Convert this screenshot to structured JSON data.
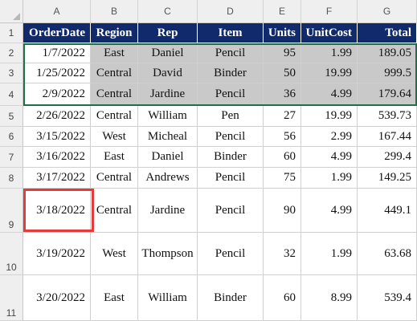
{
  "columns": [
    "A",
    "B",
    "C",
    "D",
    "E",
    "F",
    "G"
  ],
  "rows": [
    "1",
    "2",
    "3",
    "4",
    "5",
    "6",
    "7",
    "8",
    "9",
    "10",
    "11"
  ],
  "headers": [
    "OrderDate",
    "Region",
    "Rep",
    "Item",
    "Units",
    "UnitCost",
    "Total"
  ],
  "data": [
    [
      "1/7/2022",
      "East",
      "Daniel",
      "Pencil",
      "95",
      "1.99",
      "189.05"
    ],
    [
      "1/25/2022",
      "Central",
      "David",
      "Binder",
      "50",
      "19.99",
      "999.5"
    ],
    [
      "2/9/2022",
      "Central",
      "Jardine",
      "Pencil",
      "36",
      "4.99",
      "179.64"
    ],
    [
      "2/26/2022",
      "Central",
      "William",
      "Pen",
      "27",
      "19.99",
      "539.73"
    ],
    [
      "3/15/2022",
      "West",
      "Micheal",
      "Pencil",
      "56",
      "2.99",
      "167.44"
    ],
    [
      "3/16/2022",
      "East",
      "Daniel",
      "Binder",
      "60",
      "4.99",
      "299.4"
    ],
    [
      "3/17/2022",
      "Central",
      "Andrews",
      "Pencil",
      "75",
      "1.99",
      "149.25"
    ],
    [
      "3/18/2022",
      "Central",
      "Jardine",
      "Pencil",
      "90",
      "4.99",
      "449.1"
    ],
    [
      "3/19/2022",
      "West",
      "Thompson",
      "Pencil",
      "32",
      "1.99",
      "63.68"
    ],
    [
      "3/20/2022",
      "East",
      "William",
      "Binder",
      "60",
      "8.99",
      "539.4"
    ]
  ],
  "colors": {
    "header_bg": "#102a6b",
    "selection_border": "#1e7145",
    "copy_highlight": "#e63b3b",
    "selected_fill": "#c9c9c9"
  }
}
